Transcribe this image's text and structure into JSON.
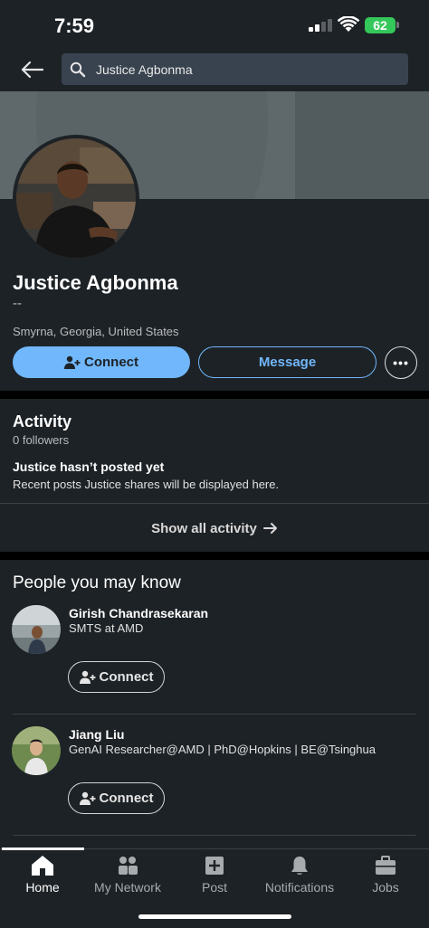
{
  "status_bar": {
    "time": "7:59",
    "battery": "62"
  },
  "search": {
    "query": "Justice Agbonma"
  },
  "profile": {
    "name": "Justice Agbonma",
    "headline": "--",
    "location": "Smyrna, Georgia, United States",
    "connect_label": "Connect",
    "message_label": "Message",
    "more_label": "•••"
  },
  "activity": {
    "title": "Activity",
    "followers": "0 followers",
    "empty_title": "Justice hasn’t posted yet",
    "empty_body": "Recent posts Justice shares will be displayed here.",
    "show_all": "Show all activity"
  },
  "people": {
    "title": "People you may know",
    "items": [
      {
        "name": "Girish Chandrasekaran",
        "title": "SMTS at AMD",
        "connect_label": "Connect"
      },
      {
        "name": "Jiang Liu",
        "title": "GenAI Researcher@AMD | PhD@Hopkins | BE@Tsinghua",
        "connect_label": "Connect"
      }
    ]
  },
  "bottom_nav": {
    "items": [
      {
        "label": "Home",
        "icon": "home-icon"
      },
      {
        "label": "My Network",
        "icon": "people-icon"
      },
      {
        "label": "Post",
        "icon": "plus-square-icon"
      },
      {
        "label": "Notifications",
        "icon": "bell-icon"
      },
      {
        "label": "Jobs",
        "icon": "briefcase-icon"
      }
    ],
    "active": "Home"
  },
  "colors": {
    "background": "#1d2226",
    "accent": "#71b7fb",
    "battery": "#34c759"
  }
}
